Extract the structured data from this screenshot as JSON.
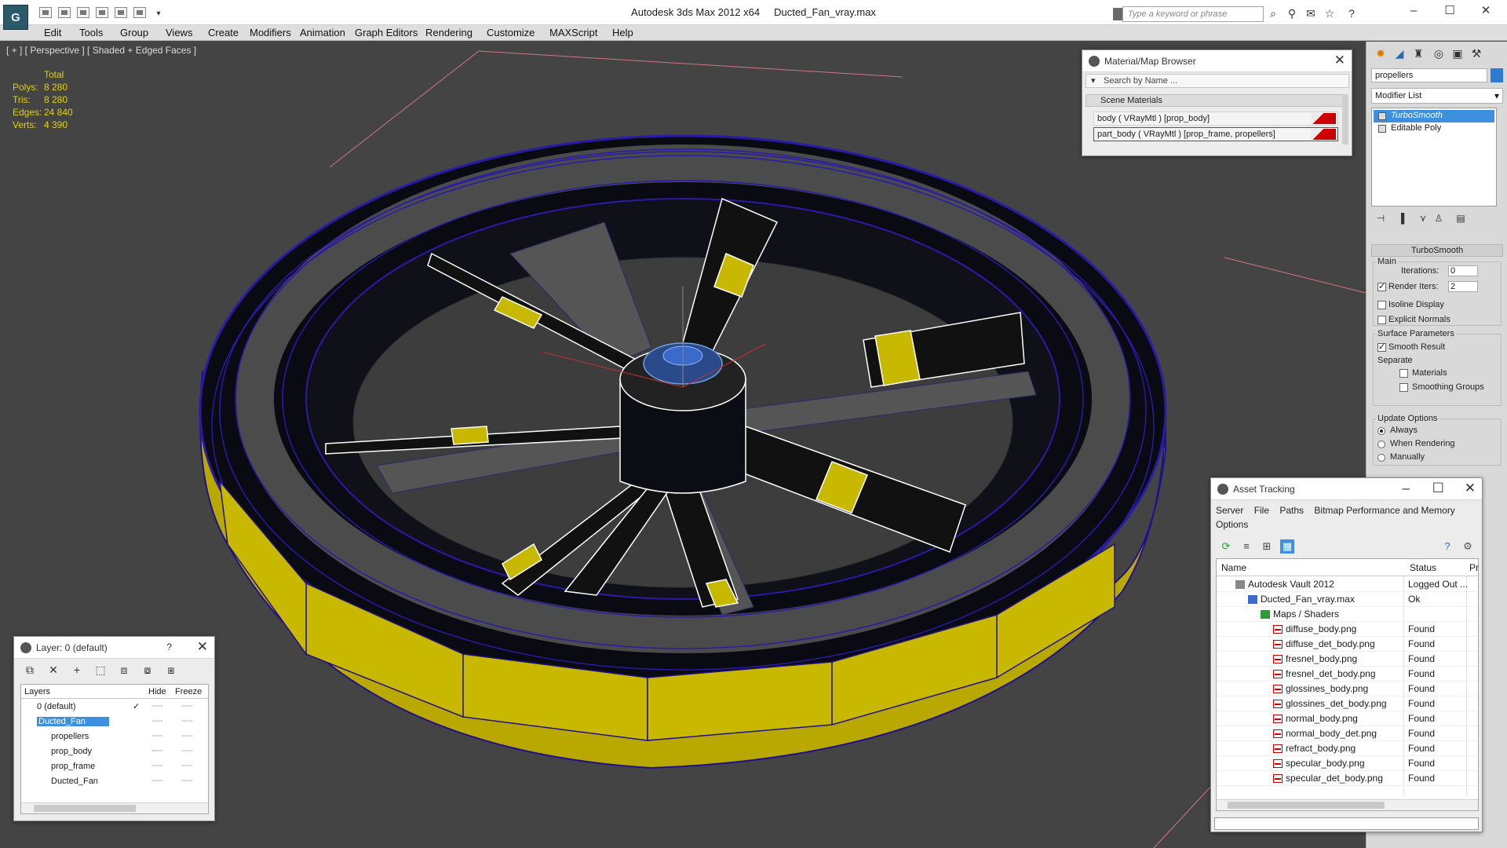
{
  "app": {
    "title_app": "Autodesk 3ds Max  2012 x64",
    "title_file": "Ducted_Fan_vray.max",
    "logo_glyph": "G",
    "search_placeholder": "Type a keyword or phrase"
  },
  "menu": [
    "Edit",
    "Tools",
    "Group",
    "Views",
    "Create",
    "Modifiers",
    "Animation",
    "Graph Editors",
    "Rendering",
    "Customize",
    "MAXScript",
    "Help"
  ],
  "viewport": {
    "label": "[ + ] [ Perspective ] [ Shaded + Edged Faces ]",
    "stats_header": "Total",
    "stats": [
      {
        "label": "Polys:",
        "value": "8 280"
      },
      {
        "label": "Tris:",
        "value": "8 280"
      },
      {
        "label": "Edges:",
        "value": "24 840"
      },
      {
        "label": "Verts:",
        "value": "4 390"
      }
    ],
    "colors": {
      "background": "#444444",
      "wire": "#2a14a0",
      "accent": "#d8c800"
    }
  },
  "material_browser": {
    "title": "Material/Map Browser",
    "search_placeholder": "Search by Name ...",
    "section": "Scene Materials",
    "items": [
      "body  ( VRayMtl ) [prop_body]",
      "part_body  ( VRayMtl ) [prop_frame, propellers]"
    ]
  },
  "command_panel": {
    "object_name": "propellers",
    "object_color": "#2a7bd1",
    "modifier_list": "Modifier List",
    "stack": [
      "TurboSmooth",
      "Editable Poly"
    ],
    "rollout_title": "TurboSmooth",
    "main_group": "Main",
    "iterations_label": "Iterations:",
    "iterations_value": "0",
    "render_iters_label": "Render Iters:",
    "render_iters_value": "2",
    "isoline": "Isoline Display",
    "explicit_normals": "Explicit Normals",
    "surface_params": "Surface Parameters",
    "smooth_result": "Smooth Result",
    "separate": "Separate",
    "materials": "Materials",
    "smoothing_groups": "Smoothing Groups",
    "update_options": "Update Options",
    "always": "Always",
    "when_rendering": "When Rendering",
    "manually": "Manually"
  },
  "layer_panel": {
    "title": "Layer: 0 (default)",
    "help": "?",
    "col_layers": "Layers",
    "col_hide": "Hide",
    "col_freeze": "Freeze",
    "dash": "----",
    "rows": [
      {
        "name": "0 (default)"
      },
      {
        "name": "Ducted_Fan"
      },
      {
        "name": "propellers"
      },
      {
        "name": "prop_body"
      },
      {
        "name": "prop_frame"
      },
      {
        "name": "Ducted_Fan"
      }
    ]
  },
  "asset_tracking": {
    "title": "Asset Tracking",
    "menu": [
      "Server",
      "File",
      "Paths",
      "Bitmap Performance and Memory",
      "Options"
    ],
    "col_name": "Name",
    "col_status": "Status",
    "col_extra": "Pr",
    "rows": [
      {
        "name": "Autodesk Vault 2012",
        "status": "Logged Out ..."
      },
      {
        "name": "Ducted_Fan_vray.max",
        "status": "Ok"
      },
      {
        "name": "Maps / Shaders",
        "status": ""
      },
      {
        "name": "diffuse_body.png",
        "status": "Found"
      },
      {
        "name": "diffuse_det_body.png",
        "status": "Found"
      },
      {
        "name": "fresnel_body.png",
        "status": "Found"
      },
      {
        "name": "fresnel_det_body.png",
        "status": "Found"
      },
      {
        "name": "glossines_body.png",
        "status": "Found"
      },
      {
        "name": "glossines_det_body.png",
        "status": "Found"
      },
      {
        "name": "normal_body.png",
        "status": "Found"
      },
      {
        "name": "normal_body_det.png",
        "status": "Found"
      },
      {
        "name": "refract_body.png",
        "status": "Found"
      },
      {
        "name": "specular_body.png",
        "status": "Found"
      },
      {
        "name": "specular_det_body.png",
        "status": "Found"
      }
    ]
  }
}
